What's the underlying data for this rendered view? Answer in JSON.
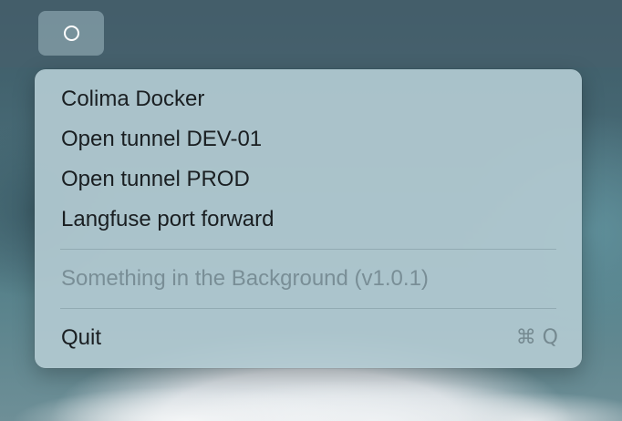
{
  "status_item": {
    "icon": "circle-outline-icon"
  },
  "menu": {
    "items": [
      {
        "label": "Colima Docker"
      },
      {
        "label": "Open tunnel DEV-01"
      },
      {
        "label": "Open tunnel PROD"
      },
      {
        "label": "Langfuse port forward"
      }
    ],
    "app_info": "Something in the Background (v1.0.1)",
    "quit": {
      "label": "Quit",
      "shortcut": "⌘ Q"
    }
  }
}
